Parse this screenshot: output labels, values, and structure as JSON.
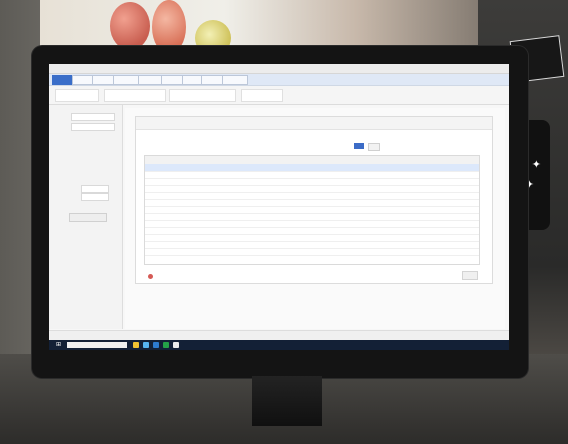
{
  "scene": {
    "background_note": "",
    "banner_text": "",
    "monitor_brand": ""
  },
  "app": {
    "window_title": "",
    "tabs": [
      "",
      "",
      "",
      "",
      "",
      "",
      "",
      "",
      ""
    ],
    "panel_title": "",
    "radio_labels": [
      "",
      ""
    ],
    "subinfo": "",
    "badge": "",
    "footer_text": "",
    "status_left": "",
    "status_mid": "",
    "tray_text": ""
  },
  "left_panel": {
    "labels": [
      "",
      "",
      "",
      "",
      "",
      "",
      ""
    ]
  },
  "table": {
    "headers": [
      "",
      "",
      "",
      "",
      "",
      "",
      "",
      "",
      "",
      ""
    ],
    "rows": [
      [
        "",
        "",
        "",
        "",
        "",
        "",
        "",
        "",
        "",
        ""
      ],
      [
        "",
        "",
        "",
        "",
        "",
        "",
        "",
        "",
        "",
        ""
      ],
      [
        "",
        "",
        "",
        "",
        "",
        "",
        "",
        "",
        "",
        ""
      ],
      [
        "",
        "",
        "",
        "",
        "",
        "",
        "",
        "",
        "",
        ""
      ],
      [
        "",
        "",
        "",
        "",
        "",
        "",
        "",
        "",
        "",
        ""
      ],
      [
        "",
        "",
        "",
        "",
        "",
        "",
        "",
        "",
        "",
        ""
      ],
      [
        "",
        "",
        "",
        "",
        "",
        "",
        "",
        "",
        "",
        ""
      ],
      [
        "",
        "",
        "",
        "",
        "",
        "",
        "",
        "",
        "",
        ""
      ],
      [
        "",
        "",
        "",
        "",
        "",
        "",
        "",
        "",
        "",
        ""
      ],
      [
        "",
        "",
        "",
        "",
        "",
        "",
        "",
        "",
        "",
        ""
      ],
      [
        "",
        "",
        "",
        "",
        "",
        "",
        "",
        "",
        "",
        ""
      ],
      [
        "",
        "",
        "",
        "",
        "",
        "",
        "",
        "",
        "",
        ""
      ],
      [
        "",
        "",
        "",
        "",
        "",
        "",
        "",
        "",
        "",
        ""
      ]
    ],
    "selected_row": 0
  },
  "colors": {
    "accent": "#3c6cc7",
    "taskbar": "#132036",
    "selected_row": "#dce8fb",
    "warning_dot": "#d55a55"
  },
  "icons": {
    "start": "windows-icon",
    "footer": "error-icon"
  }
}
